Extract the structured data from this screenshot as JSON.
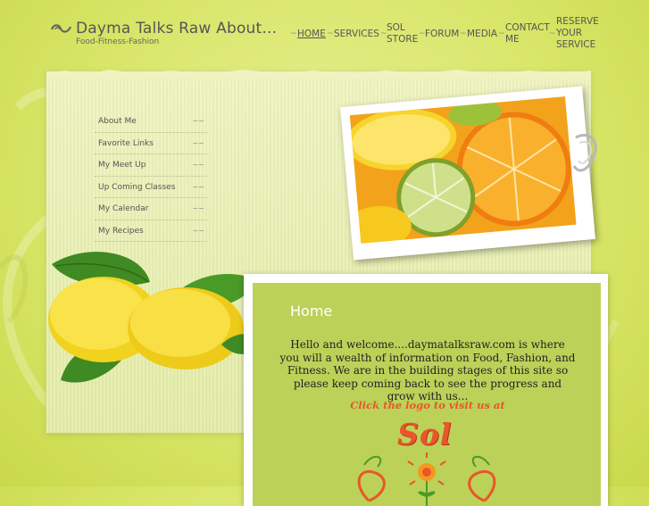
{
  "site": {
    "title": "Dayma Talks Raw About...",
    "tagline": "Food-Fitness-Fashion"
  },
  "nav": {
    "items": [
      {
        "label": "HOME",
        "active": true
      },
      {
        "label": "SERVICES",
        "active": false
      },
      {
        "label": "SOL\nSTORE",
        "active": false
      },
      {
        "label": "FORUM",
        "active": false
      },
      {
        "label": "MEDIA",
        "active": false
      },
      {
        "label": "CONTACT\nME",
        "active": false
      },
      {
        "label": "RESERVE\nYOUR\nSERVICE",
        "active": false
      }
    ]
  },
  "sidebar": {
    "items": [
      {
        "label": "About Me"
      },
      {
        "label": "Favorite Links"
      },
      {
        "label": "My Meet Up"
      },
      {
        "label": "Up Coming Classes"
      },
      {
        "label": "My Calendar"
      },
      {
        "label": "My Recipes"
      }
    ]
  },
  "content": {
    "heading": "Home",
    "welcome": "Hello and welcome....daymatalksraw.com is where you will a wealth of information on Food, Fashion, and Fitness.  We are in the building stages of this site so please keep coming back to see the progress and grow with us...",
    "cta": "Click the logo to visit us at",
    "logo_text": "Sol"
  },
  "colors": {
    "background": "#d9e66a",
    "content_panel": "#bcd158",
    "accent": "#e8562a",
    "text": "#555555"
  },
  "icons": {
    "logo": "swirl-logo-icon",
    "separator": "swirl-separator-icon"
  }
}
